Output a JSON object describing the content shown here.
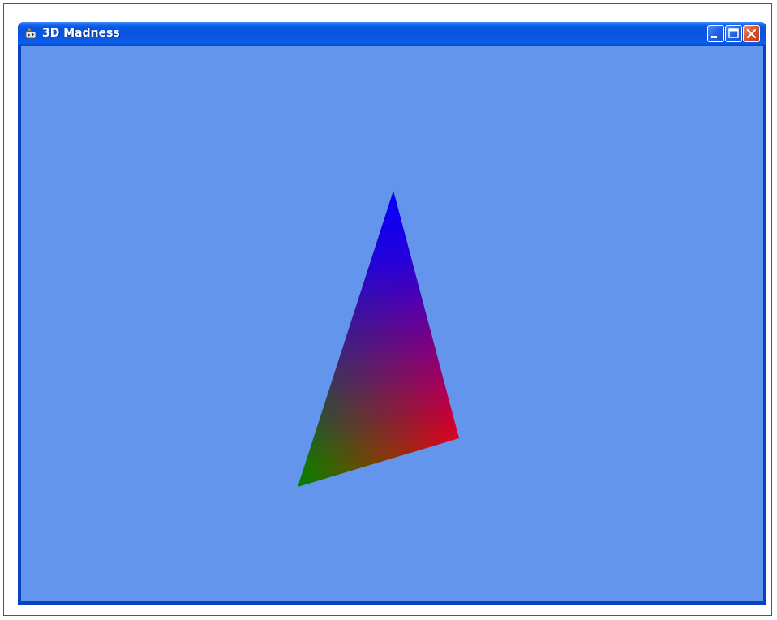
{
  "window": {
    "title": "3D Madness",
    "icons": {
      "app": "app-window-icon",
      "minimize": "minimize-icon",
      "maximize": "maximize-icon",
      "close": "close-icon"
    }
  },
  "scene": {
    "background_color": "#6495ed",
    "triangle": {
      "vertex_colors": {
        "top": "#0000ff",
        "right": "#ff0000",
        "left": "#008000"
      }
    }
  },
  "colors": {
    "titlebar": "#0754e0",
    "window_border": "#0842c4",
    "close_button": "#d9512a"
  }
}
